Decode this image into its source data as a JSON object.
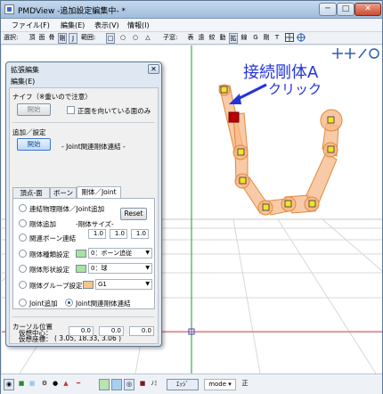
{
  "window": {
    "title": "PMDView -追加設定編集中- *",
    "min": "─",
    "max": "□",
    "close": "✕"
  },
  "menu": [
    "ファイル(F)",
    "編集(E)",
    "表示(V)",
    "情報(I)"
  ],
  "toolbar": {
    "select_label": "選択:",
    "select_items": [
      "頂",
      "面",
      "骨",
      "剛",
      "J"
    ],
    "range_label": "範囲:",
    "range_items": [
      "□",
      "○",
      "○",
      "△"
    ],
    "mode_label": "子窓:",
    "mode_items": [
      "表",
      "遠",
      "絞",
      "動",
      "拡",
      "線",
      "G",
      "剛",
      "T"
    ]
  },
  "panel": {
    "title": "拡張編集",
    "close": "✕",
    "menu": "編集(E)",
    "knife_label": "ナイフ（※重いので注意）",
    "start_button_disabled": "開始",
    "front_faces_only": "正面を向いている面のみ",
    "add_setting_label": "追加／設定",
    "start_button": "開始",
    "mode_text": "- Joint関連剛体連結 -",
    "tabs": [
      "頂点-面",
      "ボーン",
      "剛体／Joint"
    ],
    "options": {
      "link_physics": "連結物理剛体／Joint追加",
      "reset": "Reset",
      "add_rigid": "剛体追加",
      "rigid_size_label": "-剛体サイズ-",
      "size_values": [
        "1.0",
        "1.0",
        "1.0"
      ],
      "related_bone": "関連ボーン連結",
      "rigid_type": "剛体種類設定",
      "rigid_type_value": "0：ボーン追従",
      "rigid_shape": "剛体形状設定",
      "rigid_shape_value": "0：球",
      "rigid_group": "剛体グループ設定",
      "rigid_group_value": "G1",
      "joint_add": "Joint追加",
      "joint_link": "Joint関連剛体連結"
    },
    "cursor_label": "カーソル位置",
    "virtual_coords_label": "仮想座標：",
    "virtual_coords_value": "( 3.05, 18.33, 3.06 )",
    "virtual_center_label": "仮想中心：",
    "virtual_center_values": [
      "0.0",
      "0.0",
      "0.0"
    ],
    "colors": {
      "rigid_type_swatch": "#a6e3a0",
      "rigid_shape_swatch": "#a6e3a0",
      "rigid_group_swatch": "#f5c68a"
    }
  },
  "annotation": {
    "line1": "接続剛体A",
    "line2": "クリック",
    "color": "#2233dd"
  },
  "bottombar": {
    "mode_value": "mode",
    "mode_extra": "正",
    "tool_text": "ｴｯｼﾞ",
    "tool_text2": "ﾉﾐ"
  }
}
